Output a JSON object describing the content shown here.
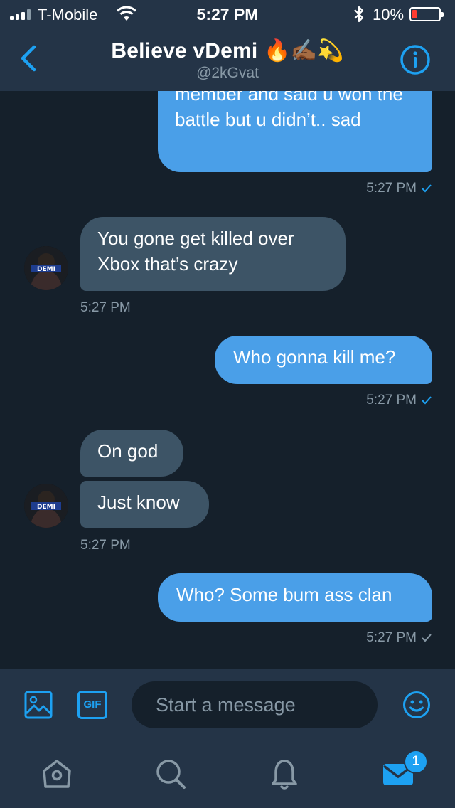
{
  "status_bar": {
    "carrier": "T-Mobile",
    "time": "5:27 PM",
    "battery": "10%"
  },
  "header": {
    "title": "Believe vDemi 🔥✍🏾💫",
    "handle": "@2kGvat"
  },
  "messages": [
    {
      "direction": "out",
      "text": "member and said u won the battle but u didn’t.. sad",
      "time": "5:27 PM",
      "read": true
    },
    {
      "direction": "in",
      "text": "You gone get killed over Xbox that’s crazy",
      "time": "5:27 PM"
    },
    {
      "direction": "out",
      "text": "Who gonna kill me?",
      "time": "5:27 PM",
      "read": true
    },
    {
      "direction": "in",
      "text": "On god"
    },
    {
      "direction": "in",
      "text": "Just know",
      "time": "5:27 PM"
    },
    {
      "direction": "out",
      "text": "Who? Some bum ass clan",
      "time": "5:27 PM",
      "read": false
    }
  ],
  "avatar_text": "DEMI",
  "composer": {
    "placeholder": "Start a message",
    "gif_label": "GIF"
  },
  "tabbar": {
    "messages_badge": "1"
  },
  "colors": {
    "background": "#15202b",
    "header": "#243447",
    "outgoing_bubble": "#4a9fe8",
    "incoming_bubble": "#3d5466",
    "accent": "#1da1f2",
    "muted_text": "#8899a6"
  }
}
